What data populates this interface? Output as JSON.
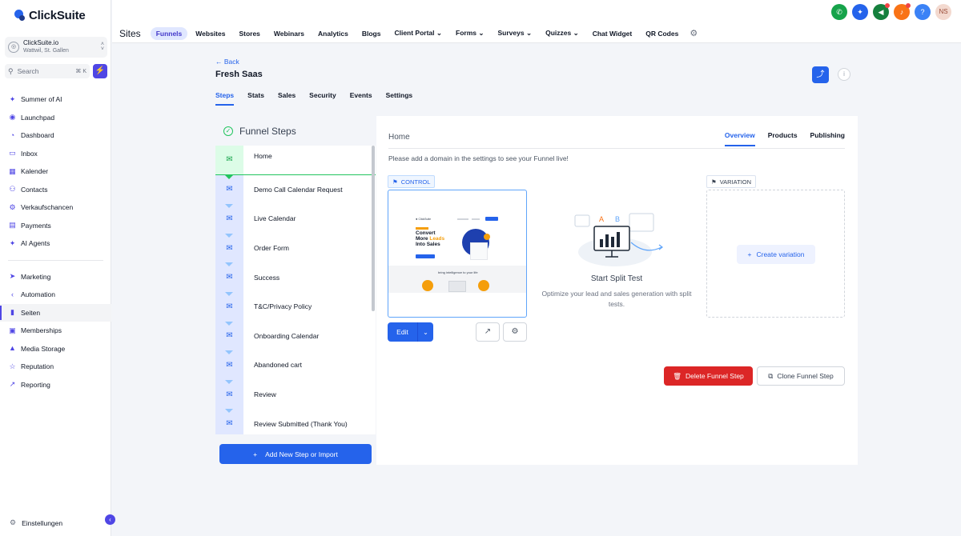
{
  "brand": {
    "name": "ClickSuite"
  },
  "account": {
    "name": "ClickSuite.io",
    "location": "Wattwil, St. Gallen"
  },
  "search": {
    "placeholder": "Search",
    "shortcut": "⌘ K"
  },
  "sidebar": {
    "items": [
      {
        "label": "Summer of AI",
        "icon": "sparkle-icon"
      },
      {
        "label": "Launchpad",
        "icon": "rocket-icon"
      },
      {
        "label": "Dashboard",
        "icon": "chart-icon"
      },
      {
        "label": "Inbox",
        "icon": "chat-icon"
      },
      {
        "label": "Kalender",
        "icon": "calendar-icon"
      },
      {
        "label": "Contacts",
        "icon": "contacts-icon"
      },
      {
        "label": "Verkaufschancen",
        "icon": "funnel-icon"
      },
      {
        "label": "Payments",
        "icon": "payments-icon"
      },
      {
        "label": "AI Agents",
        "icon": "sparkle-icon"
      }
    ],
    "items2": [
      {
        "label": "Marketing",
        "icon": "send-icon"
      },
      {
        "label": "Automation",
        "icon": "automation-icon"
      },
      {
        "label": "Seiten",
        "icon": "pages-icon",
        "active": true
      },
      {
        "label": "Memberships",
        "icon": "membership-icon"
      },
      {
        "label": "Media Storage",
        "icon": "media-icon"
      },
      {
        "label": "Reputation",
        "icon": "star-icon"
      },
      {
        "label": "Reporting",
        "icon": "reporting-icon"
      }
    ],
    "settings_label": "Einstellungen"
  },
  "topbar": {
    "icons": [
      {
        "name": "phone-icon",
        "color": "#16a34a"
      },
      {
        "name": "ai-icon",
        "color": "#2563eb"
      },
      {
        "name": "megaphone-icon",
        "color": "#15803d",
        "badge": true
      },
      {
        "name": "bell-icon",
        "color": "#f97316",
        "badge": true
      },
      {
        "name": "help-icon",
        "color": "#3b82f6"
      }
    ],
    "avatar_initials": "NS"
  },
  "subnav": {
    "title": "Sites",
    "tabs": [
      {
        "label": "Funnels",
        "active": true
      },
      {
        "label": "Websites"
      },
      {
        "label": "Stores"
      },
      {
        "label": "Webinars"
      },
      {
        "label": "Analytics"
      },
      {
        "label": "Blogs"
      },
      {
        "label": "Client Portal",
        "dropdown": true
      },
      {
        "label": "Forms",
        "dropdown": true
      },
      {
        "label": "Surveys",
        "dropdown": true
      },
      {
        "label": "Quizzes",
        "dropdown": true
      },
      {
        "label": "Chat Widget"
      },
      {
        "label": "QR Codes"
      }
    ]
  },
  "page": {
    "back_label": "Back",
    "title": "Fresh Saas",
    "tabs": [
      {
        "label": "Steps",
        "active": true
      },
      {
        "label": "Stats"
      },
      {
        "label": "Sales"
      },
      {
        "label": "Security"
      },
      {
        "label": "Events"
      },
      {
        "label": "Settings"
      }
    ]
  },
  "funnel": {
    "header": "Funnel Steps",
    "steps": [
      "Home",
      "Demo Call Calendar Request",
      "Live Calendar",
      "Order Form",
      "Success",
      "T&C/Privacy Policy",
      "Onboarding Calendar",
      "Abandoned cart",
      "Review",
      "Review Submitted (Thank You)"
    ],
    "add_button": "Add New Step or Import"
  },
  "detail": {
    "title": "Home",
    "tabs": [
      {
        "label": "Overview",
        "active": true
      },
      {
        "label": "Products"
      },
      {
        "label": "Publishing"
      }
    ],
    "note": "Please add a domain in the settings to see your Funnel live!",
    "control_label": "CONTROL",
    "variation_label": "VARIATION",
    "preview": {
      "headline_1": "Convert",
      "headline_2a": "More ",
      "headline_2b": "Leads",
      "headline_3": "Into Sales",
      "band_text": "bring intelligence to your life"
    },
    "edit_label": "Edit",
    "split_title": "Start Split Test",
    "split_desc": "Optimize your lead and sales generation with split tests.",
    "create_variation": "Create variation",
    "delete_label": "Delete Funnel Step",
    "clone_label": "Clone Funnel Step"
  }
}
